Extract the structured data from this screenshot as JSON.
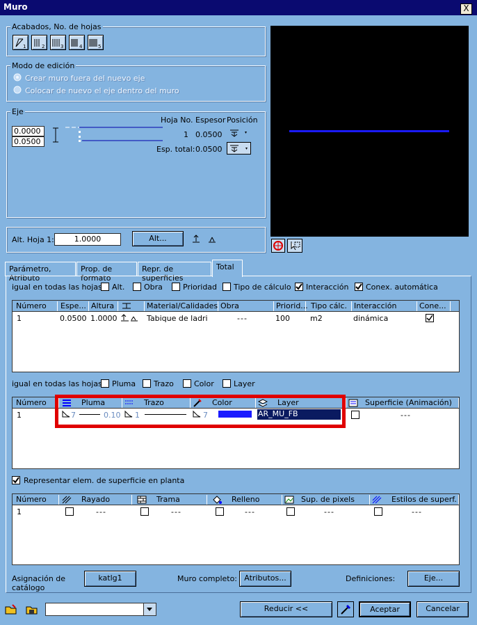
{
  "window": {
    "title": "Muro",
    "close": "X"
  },
  "acabados": {
    "label": "Acabados, No. de hojas",
    "buttons": [
      "1",
      "2",
      "3",
      "4",
      "5"
    ]
  },
  "modo": {
    "label": "Modo de edición",
    "opt1": "Crear muro fuera del nuevo eje",
    "opt2": "Colocar de nuevo el eje dentro del muro"
  },
  "eje": {
    "label": "Eje",
    "val1": "0.0000",
    "val2": "0.0500",
    "col_hoja": "Hoja No.",
    "col_espesor": "Espesor",
    "col_posicion": "Posición",
    "row_hoja": "1",
    "row_espesor": "0.0500",
    "esp_total_label": "Esp. total:",
    "esp_total": "0.0500"
  },
  "alt": {
    "label": "Alt. Hoja 1:",
    "value": "1.0000",
    "button": "Alt..."
  },
  "tabs": [
    "Parámetro, Atributo",
    "Prop. de formato",
    "Repr. de superficies",
    "Total"
  ],
  "igual1": {
    "label": "igual en todas las hojas:",
    "items": [
      {
        "label": "Alt.",
        "checked": false
      },
      {
        "label": "Obra",
        "checked": false
      },
      {
        "label": "Prioridad",
        "checked": false
      },
      {
        "label": "Tipo de cálculo",
        "checked": false
      },
      {
        "label": "Interacción",
        "checked": true
      },
      {
        "label": "Conex. automática",
        "checked": true
      }
    ]
  },
  "table1": {
    "headers": [
      "Número",
      "Espe...",
      "Altura",
      "",
      "Material/Calidades",
      "Obra",
      "Priorid...",
      "Tipo cálc.",
      "Interacción",
      "Cone..."
    ],
    "row": {
      "numero": "1",
      "espesor": "0.0500",
      "altura": "1.0000",
      "material": "Tabique de ladri",
      "obra": "---",
      "prioridad": "100",
      "tipo": "m2",
      "interaccion": "dinámica"
    }
  },
  "igual2": {
    "label": "igual en todas las hojas:",
    "items": [
      {
        "label": "Pluma"
      },
      {
        "label": "Trazo"
      },
      {
        "label": "Color"
      },
      {
        "label": "Layer"
      }
    ]
  },
  "table2": {
    "headers": [
      "Número",
      "Pluma",
      "Trazo",
      "Color",
      "Layer",
      "Superficie (Animación)"
    ],
    "row": {
      "numero": "1",
      "pluma_num": "7",
      "pluma_val": "0.10",
      "trazo_num": "1",
      "color_num": "7",
      "layer": "AR_MU_FB",
      "sup": "---"
    }
  },
  "representar": {
    "label": "Representar elem. de superficie en planta",
    "checked": true
  },
  "table3": {
    "headers": [
      "Número",
      "Rayado",
      "Trama",
      "Relleno",
      "Sup. de pixels",
      "Estilos de superf."
    ],
    "row": {
      "numero": "1",
      "dash": "---"
    }
  },
  "bottom": {
    "asignacion": "Asignación de catálogo",
    "katlg": "katlg1",
    "muro": "Muro completo:",
    "atributos": "Atributos...",
    "definiciones": "Definiciones:",
    "eje": "Eje..."
  },
  "footer": {
    "reducir": "Reducir <<",
    "aceptar": "Aceptar",
    "cancelar": "Cancelar"
  },
  "colors": {
    "accent_red": "#e00000",
    "preview_bg": "#000000",
    "line_blue": "#1a1aff"
  }
}
